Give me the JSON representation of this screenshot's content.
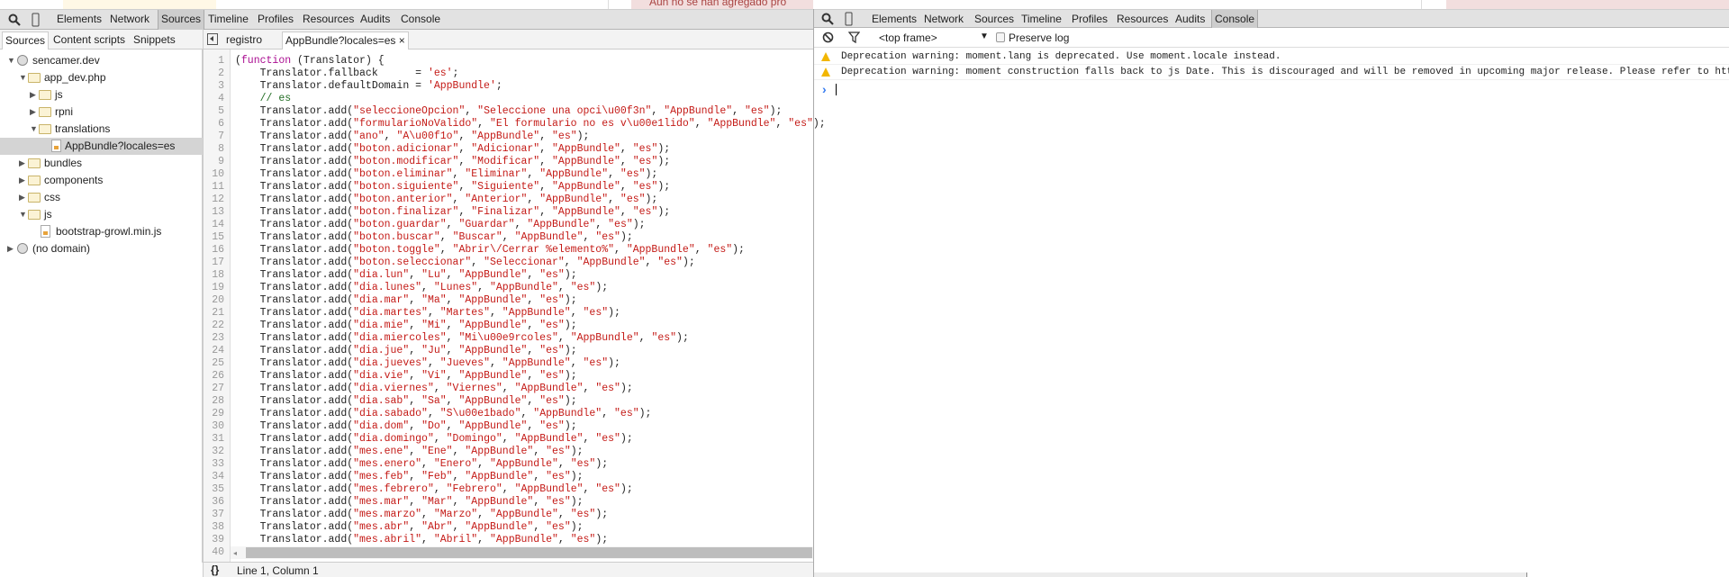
{
  "page_behind": {
    "alert_text": "Aun no se han agregado pro"
  },
  "left_devtools": {
    "toolbar": {
      "tabs": [
        "Elements",
        "Network",
        "Sources",
        "Timeline",
        "Profiles",
        "Resources",
        "Audits",
        "Console"
      ],
      "selected": "Sources"
    },
    "navigator_tabs": [
      "Sources",
      "Content scripts",
      "Snippets"
    ],
    "editor_tabs": [
      {
        "label": "registro"
      },
      {
        "label": "AppBundle?locales=es",
        "close": "×"
      }
    ],
    "tree": [
      {
        "label": "sencamer.dev",
        "type": "domain",
        "expanded": true
      },
      {
        "label": "app_dev.php",
        "type": "folder",
        "expanded": true
      },
      {
        "label": "js",
        "type": "folder",
        "expanded": false
      },
      {
        "label": "rpni",
        "type": "folder",
        "expanded": false
      },
      {
        "label": "translations",
        "type": "folder",
        "expanded": true
      },
      {
        "label": "AppBundle?locales=es",
        "type": "file",
        "selected": true
      },
      {
        "label": "bundles",
        "type": "folder",
        "expanded": false
      },
      {
        "label": "components",
        "type": "folder",
        "expanded": false
      },
      {
        "label": "css",
        "type": "folder",
        "expanded": false
      },
      {
        "label": "js",
        "type": "folder",
        "expanded": true
      },
      {
        "label": "bootstrap-growl.min.js",
        "type": "file"
      },
      {
        "label": "(no domain)",
        "type": "domain",
        "expanded": false
      }
    ],
    "code_lines": [
      "(function (Translator) {",
      "    Translator.fallback      = 'es';",
      "    Translator.defaultDomain = 'AppBundle';",
      "    // es",
      "    Translator.add(\"seleccioneOpcion\", \"Seleccione una opci\\u00f3n\", \"AppBundle\", \"es\");",
      "    Translator.add(\"formularioNoValido\", \"El formulario no es v\\u00e1lido\", \"AppBundle\", \"es\");",
      "    Translator.add(\"ano\", \"A\\u00f1o\", \"AppBundle\", \"es\");",
      "    Translator.add(\"boton.adicionar\", \"Adicionar\", \"AppBundle\", \"es\");",
      "    Translator.add(\"boton.modificar\", \"Modificar\", \"AppBundle\", \"es\");",
      "    Translator.add(\"boton.eliminar\", \"Eliminar\", \"AppBundle\", \"es\");",
      "    Translator.add(\"boton.siguiente\", \"Siguiente\", \"AppBundle\", \"es\");",
      "    Translator.add(\"boton.anterior\", \"Anterior\", \"AppBundle\", \"es\");",
      "    Translator.add(\"boton.finalizar\", \"Finalizar\", \"AppBundle\", \"es\");",
      "    Translator.add(\"boton.guardar\", \"Guardar\", \"AppBundle\", \"es\");",
      "    Translator.add(\"boton.buscar\", \"Buscar\", \"AppBundle\", \"es\");",
      "    Translator.add(\"boton.toggle\", \"Abrir\\/Cerrar %elemento%\", \"AppBundle\", \"es\");",
      "    Translator.add(\"boton.seleccionar\", \"Seleccionar\", \"AppBundle\", \"es\");",
      "    Translator.add(\"dia.lun\", \"Lu\", \"AppBundle\", \"es\");",
      "    Translator.add(\"dia.lunes\", \"Lunes\", \"AppBundle\", \"es\");",
      "    Translator.add(\"dia.mar\", \"Ma\", \"AppBundle\", \"es\");",
      "    Translator.add(\"dia.martes\", \"Martes\", \"AppBundle\", \"es\");",
      "    Translator.add(\"dia.mie\", \"Mi\", \"AppBundle\", \"es\");",
      "    Translator.add(\"dia.miercoles\", \"Mi\\u00e9rcoles\", \"AppBundle\", \"es\");",
      "    Translator.add(\"dia.jue\", \"Ju\", \"AppBundle\", \"es\");",
      "    Translator.add(\"dia.jueves\", \"Jueves\", \"AppBundle\", \"es\");",
      "    Translator.add(\"dia.vie\", \"Vi\", \"AppBundle\", \"es\");",
      "    Translator.add(\"dia.viernes\", \"Viernes\", \"AppBundle\", \"es\");",
      "    Translator.add(\"dia.sab\", \"Sa\", \"AppBundle\", \"es\");",
      "    Translator.add(\"dia.sabado\", \"S\\u00e1bado\", \"AppBundle\", \"es\");",
      "    Translator.add(\"dia.dom\", \"Do\", \"AppBundle\", \"es\");",
      "    Translator.add(\"dia.domingo\", \"Domingo\", \"AppBundle\", \"es\");",
      "    Translator.add(\"mes.ene\", \"Ene\", \"AppBundle\", \"es\");",
      "    Translator.add(\"mes.enero\", \"Enero\", \"AppBundle\", \"es\");",
      "    Translator.add(\"mes.feb\", \"Feb\", \"AppBundle\", \"es\");",
      "    Translator.add(\"mes.febrero\", \"Febrero\", \"AppBundle\", \"es\");",
      "    Translator.add(\"mes.mar\", \"Mar\", \"AppBundle\", \"es\");",
      "    Translator.add(\"mes.marzo\", \"Marzo\", \"AppBundle\", \"es\");",
      "    Translator.add(\"mes.abr\", \"Abr\", \"AppBundle\", \"es\");",
      "    Translator.add(\"mes.abril\", \"Abril\", \"AppBundle\", \"es\");",
      ""
    ],
    "status": {
      "format_icon": "{}",
      "position": "Line 1, Column 1"
    }
  },
  "right_devtools": {
    "toolbar": {
      "tabs": [
        "Elements",
        "Network",
        "Sources",
        "Timeline",
        "Profiles",
        "Resources",
        "Audits",
        "Console"
      ],
      "selected": "Console"
    },
    "console_toolbar": {
      "frame_select": "<top frame>",
      "preserve_log_label": "Preserve log",
      "preserve_log_checked": false
    },
    "messages": [
      {
        "level": "warning",
        "text": "Deprecation warning: moment.lang is deprecated. Use moment.locale instead."
      },
      {
        "level": "warning",
        "text": "Deprecation warning: moment construction falls back to js Date. This is discouraged and will be removed in upcoming major release. Please refer to htt"
      }
    ],
    "prompt": "›"
  },
  "colors": {
    "keyword": "#aa0d91",
    "string": "#c41a16",
    "comment": "#236e25",
    "warning": "#f2b600",
    "prompt": "#367cf1"
  }
}
